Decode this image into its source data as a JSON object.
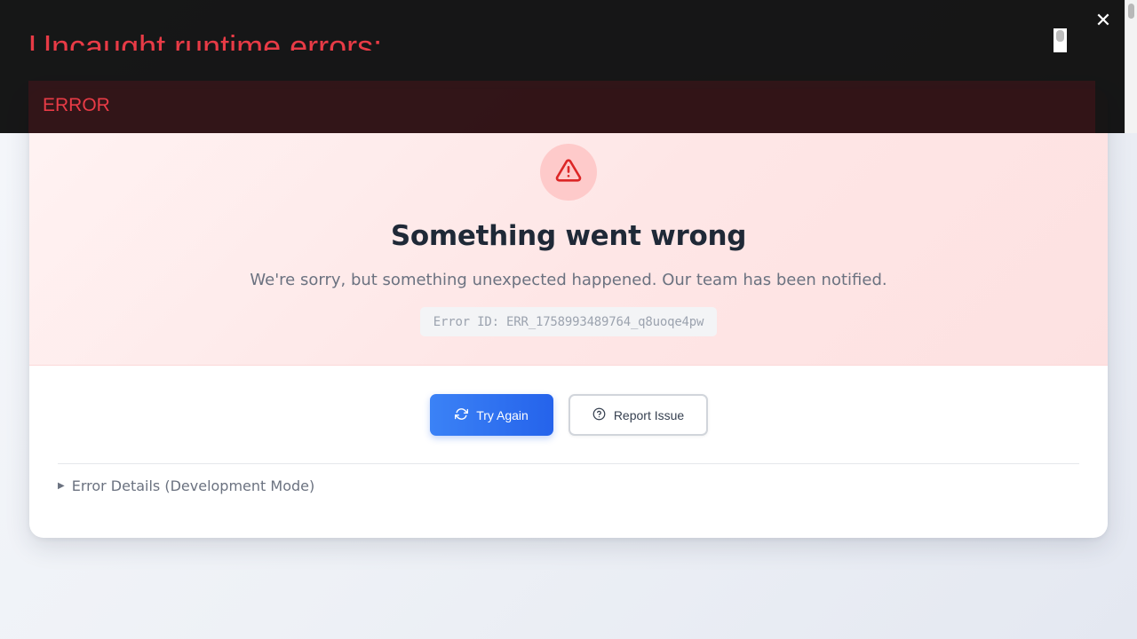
{
  "overlay": {
    "title": "Uncaught runtime errors:",
    "error_label": "ERROR",
    "close_glyph": "✕",
    "title_color": "#e83b46"
  },
  "card": {
    "icon": "warning-triangle-icon",
    "title": "Something went wrong",
    "message": "We're sorry, but something unexpected happened. Our team has been notified.",
    "error_id": "Error ID: ERR_1758993489764_q8uoqe4pw",
    "try_again_label": "Try Again",
    "try_again_icon": "refresh-icon",
    "report_label": "Report Issue",
    "report_icon": "help-circle-icon",
    "details_label": "Error Details (Development Mode)",
    "details_expanded": false
  },
  "colors": {
    "primary": "#2563eb",
    "danger": "#dc2626",
    "danger_bg": "#fecaca",
    "heading": "#1f2937",
    "muted": "#6b7280"
  }
}
